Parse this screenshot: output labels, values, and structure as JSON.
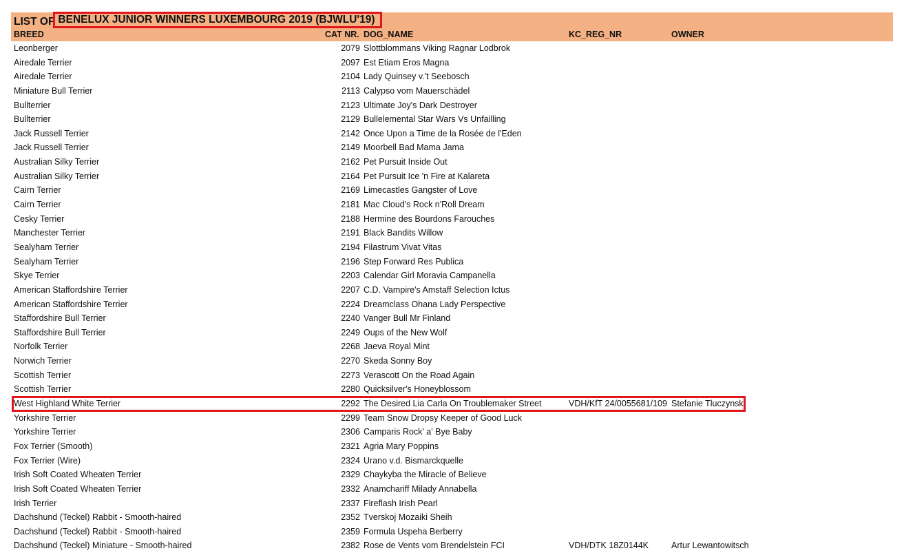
{
  "title": {
    "prefix": "LIST OF ",
    "highlight": "BENELUX JUNIOR WINNERS LUXEMBOURG 2019 (BJWLU'19)"
  },
  "columns": {
    "breed": "BREED",
    "cat_nr": "CAT NR.",
    "dog_name": "DOG_NAME",
    "kc_reg_nr": "KC_REG_NR",
    "owner": "OWNER"
  },
  "rows": [
    {
      "breed": "Leonberger",
      "cat_nr": "2079",
      "dog_name": "Slottblommans Viking Ragnar Lodbrok",
      "kc_reg_nr": "",
      "owner": ""
    },
    {
      "breed": "Airedale Terrier",
      "cat_nr": "2097",
      "dog_name": "Est Etiam Eros Magna",
      "kc_reg_nr": "",
      "owner": ""
    },
    {
      "breed": "Airedale Terrier",
      "cat_nr": "2104",
      "dog_name": "Lady Quinsey v.'t Seebosch",
      "kc_reg_nr": "",
      "owner": ""
    },
    {
      "breed": "Miniature Bull Terrier",
      "cat_nr": "2113",
      "dog_name": "Calypso vom Mauerschädel",
      "kc_reg_nr": "",
      "owner": ""
    },
    {
      "breed": "Bullterrier",
      "cat_nr": "2123",
      "dog_name": "Ultimate Joy's Dark Destroyer",
      "kc_reg_nr": "",
      "owner": ""
    },
    {
      "breed": "Bullterrier",
      "cat_nr": "2129",
      "dog_name": "Bullelemental Star Wars Vs Unfailling",
      "kc_reg_nr": "",
      "owner": ""
    },
    {
      "breed": "Jack Russell Terrier",
      "cat_nr": "2142",
      "dog_name": "Once Upon a Time de la Rosée de l'Eden",
      "kc_reg_nr": "",
      "owner": ""
    },
    {
      "breed": "Jack Russell Terrier",
      "cat_nr": "2149",
      "dog_name": "Moorbell Bad Mama Jama",
      "kc_reg_nr": "",
      "owner": ""
    },
    {
      "breed": "Australian Silky Terrier",
      "cat_nr": "2162",
      "dog_name": "Pet Pursuit Inside Out",
      "kc_reg_nr": "",
      "owner": ""
    },
    {
      "breed": "Australian Silky Terrier",
      "cat_nr": "2164",
      "dog_name": "Pet Pursuit Ice 'n Fire at Kalareta",
      "kc_reg_nr": "",
      "owner": ""
    },
    {
      "breed": "Cairn Terrier",
      "cat_nr": "2169",
      "dog_name": "Limecastles Gangster of Love",
      "kc_reg_nr": "",
      "owner": ""
    },
    {
      "breed": "Cairn Terrier",
      "cat_nr": "2181",
      "dog_name": "Mac Cloud's Rock n'Roll Dream",
      "kc_reg_nr": "",
      "owner": ""
    },
    {
      "breed": "Cesky Terrier",
      "cat_nr": "2188",
      "dog_name": "Hermine des Bourdons Farouches",
      "kc_reg_nr": "",
      "owner": ""
    },
    {
      "breed": "Manchester Terrier",
      "cat_nr": "2191",
      "dog_name": "Black Bandits Willow",
      "kc_reg_nr": "",
      "owner": ""
    },
    {
      "breed": "Sealyham Terrier",
      "cat_nr": "2194",
      "dog_name": "Filastrum Vivat Vitas",
      "kc_reg_nr": "",
      "owner": ""
    },
    {
      "breed": "Sealyham Terrier",
      "cat_nr": "2196",
      "dog_name": "Step Forward Res Publica",
      "kc_reg_nr": "",
      "owner": ""
    },
    {
      "breed": "Skye Terrier",
      "cat_nr": "2203",
      "dog_name": "Calendar Girl Moravia Campanella",
      "kc_reg_nr": "",
      "owner": ""
    },
    {
      "breed": "American Staffordshire Terrier",
      "cat_nr": "2207",
      "dog_name": "C.D. Vampire's Amstaff Selection Ictus",
      "kc_reg_nr": "",
      "owner": ""
    },
    {
      "breed": "American Staffordshire Terrier",
      "cat_nr": "2224",
      "dog_name": "Dreamclass Ohana Lady Perspective",
      "kc_reg_nr": "",
      "owner": ""
    },
    {
      "breed": "Staffordshire Bull Terrier",
      "cat_nr": "2240",
      "dog_name": "Vanger Bull Mr Finland",
      "kc_reg_nr": "",
      "owner": ""
    },
    {
      "breed": "Staffordshire Bull Terrier",
      "cat_nr": "2249",
      "dog_name": "Oups of the New Wolf",
      "kc_reg_nr": "",
      "owner": ""
    },
    {
      "breed": "Norfolk Terrier",
      "cat_nr": "2268",
      "dog_name": "Jaeva Royal Mint",
      "kc_reg_nr": "",
      "owner": ""
    },
    {
      "breed": "Norwich Terrier",
      "cat_nr": "2270",
      "dog_name": "Skeda Sonny Boy",
      "kc_reg_nr": "",
      "owner": ""
    },
    {
      "breed": "Scottish Terrier",
      "cat_nr": "2273",
      "dog_name": "Verascott On the Road Again",
      "kc_reg_nr": "",
      "owner": ""
    },
    {
      "breed": "Scottish Terrier",
      "cat_nr": "2280",
      "dog_name": "Quicksilver's Honeyblossom",
      "kc_reg_nr": "",
      "owner": ""
    },
    {
      "breed": "West Highland White Terrier",
      "cat_nr": "2292",
      "dog_name": "The Desired Lia Carla On Troublemaker Street",
      "kc_reg_nr": "VDH/KfT 24/0055681/109",
      "owner": "Stefanie Tluczynski"
    },
    {
      "breed": "Yorkshire Terrier",
      "cat_nr": "2299",
      "dog_name": "Team Snow Dropsy Keeper of Good Luck",
      "kc_reg_nr": "",
      "owner": ""
    },
    {
      "breed": "Yorkshire Terrier",
      "cat_nr": "2306",
      "dog_name": "Camparis Rock' a' Bye Baby",
      "kc_reg_nr": "",
      "owner": ""
    },
    {
      "breed": "Fox Terrier (Smooth)",
      "cat_nr": "2321",
      "dog_name": "Agria Mary Poppins",
      "kc_reg_nr": "",
      "owner": ""
    },
    {
      "breed": "Fox Terrier (Wire)",
      "cat_nr": "2324",
      "dog_name": "Urano v.d. Bismarckquelle",
      "kc_reg_nr": "",
      "owner": ""
    },
    {
      "breed": "Irish Soft Coated Wheaten Terrier",
      "cat_nr": "2329",
      "dog_name": "Chaykyba the Miracle of Believe",
      "kc_reg_nr": "",
      "owner": ""
    },
    {
      "breed": "Irish Soft Coated Wheaten Terrier",
      "cat_nr": "2332",
      "dog_name": "Anamchariff Milady Annabella",
      "kc_reg_nr": "",
      "owner": ""
    },
    {
      "breed": "Irish Terrier",
      "cat_nr": "2337",
      "dog_name": "Fireflash Irish Pearl",
      "kc_reg_nr": "",
      "owner": ""
    },
    {
      "breed": "Dachshund (Teckel) Rabbit - Smooth-haired",
      "cat_nr": "2352",
      "dog_name": "Tverskoj Mozaiki Sheih",
      "kc_reg_nr": "",
      "owner": ""
    },
    {
      "breed": "Dachshund (Teckel) Rabbit - Smooth-haired",
      "cat_nr": "2359",
      "dog_name": "Formula Uspeha Berberry",
      "kc_reg_nr": "",
      "owner": ""
    },
    {
      "breed": "Dachshund (Teckel) Miniature - Smooth-haired",
      "cat_nr": "2382",
      "dog_name": "Rose de Vents vom Brendelstein FCI",
      "kc_reg_nr": "VDH/DTK 18Z0144K",
      "owner": "Artur Lewantowitsch"
    }
  ],
  "highlighted_row_index": 25,
  "colors": {
    "header_band": "#f4b183",
    "highlight_border": "#e0161b",
    "text": "#111111"
  }
}
